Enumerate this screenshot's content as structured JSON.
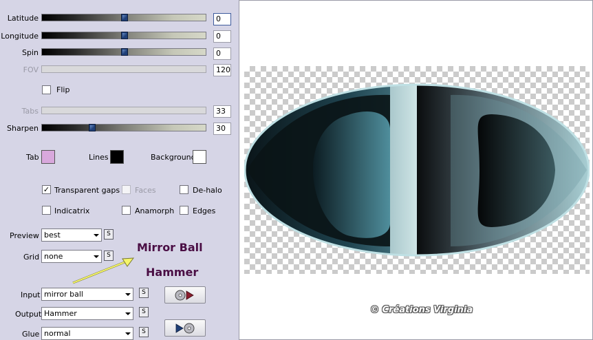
{
  "params": {
    "latitude": {
      "label": "Latitude",
      "value": "0",
      "position": 0.5
    },
    "longitude": {
      "label": "Longitude",
      "value": "0",
      "position": 0.5
    },
    "spin": {
      "label": "Spin",
      "value": "0",
      "position": 0.5
    },
    "fov": {
      "label": "FOV",
      "value": "120"
    },
    "tabs": {
      "label": "Tabs",
      "value": "33"
    },
    "sharpen": {
      "label": "Sharpen",
      "value": "30",
      "position": 0.3
    }
  },
  "flip": {
    "label": "Flip",
    "checked": false
  },
  "colors": {
    "tab": {
      "label": "Tab",
      "color": "#d8a8dc"
    },
    "lines": {
      "label": "Lines",
      "color": "#000000"
    },
    "background": {
      "label": "Background",
      "color": "#ffffff"
    }
  },
  "options": {
    "transparent_gaps": {
      "label": "Transparent gaps",
      "checked": true,
      "mark": "✓"
    },
    "faces": {
      "label": "Faces",
      "checked": false,
      "disabled": true
    },
    "de_halo": {
      "label": "De-halo",
      "checked": false
    },
    "indicatrix": {
      "label": "Indicatrix",
      "checked": false
    },
    "anamorph": {
      "label": "Anamorph",
      "checked": false
    },
    "edges": {
      "label": "Edges",
      "checked": false
    }
  },
  "preview": {
    "label": "Preview",
    "value": "best"
  },
  "grid": {
    "label": "Grid",
    "value": "none"
  },
  "input": {
    "label": "Input",
    "value": "mirror ball"
  },
  "output": {
    "label": "Output",
    "value": "Hammer"
  },
  "glue": {
    "label": "Glue",
    "value": "normal"
  },
  "s_button_label": "S",
  "annotation": {
    "line1": "Mirror Ball",
    "line2": "Hammer",
    "color": "#4a0e44",
    "arrow_color": "#f5f56a"
  },
  "credit": "© Créations Virginia"
}
